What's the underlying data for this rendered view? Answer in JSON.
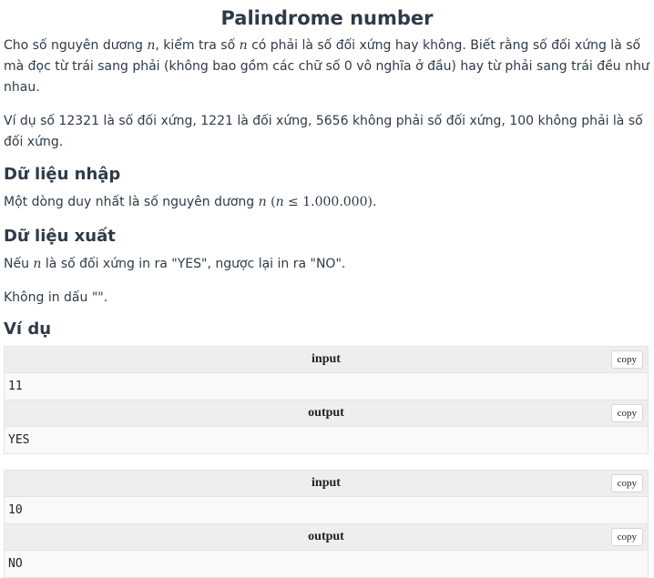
{
  "title": "Palindrome number",
  "intro": {
    "part1": "Cho số nguyên dương ",
    "var_n": "n",
    "part2": ", kiểm tra số ",
    "part3": " có phải là số đối xứng hay không. Biết rằng số đối xứng là số mà đọc từ trái sang phải (không bao gồm các chữ số 0 vô nghĩa ở đầu) hay từ phải sang trái đều như nhau."
  },
  "example_line": "Ví dụ số 12321 là số đối xứng, 1221 là đối xứng, 5656 không phải số đối xứng, 100 không phải là số đối xứng.",
  "input_section": {
    "heading": "Dữ liệu nhập",
    "text": "Một dòng duy nhất là số nguyên dương ",
    "constraint_open": "(",
    "constraint_var": "n",
    "constraint_op": " ≤ 1.000.000",
    "constraint_close": ")."
  },
  "output_section": {
    "heading": "Dữ liệu xuất",
    "text_prefix": "Nếu ",
    "text_suffix": " là số đối xứng in ra \"YES\", ngược lại in ra \"NO\".",
    "note": "Không in dấu \"\"."
  },
  "examples_heading": "Ví dụ",
  "samples": [
    {
      "input_label": "input",
      "input_value": "11",
      "output_label": "output",
      "output_value": "YES",
      "copy_label": "copy"
    },
    {
      "input_label": "input",
      "input_value": "10",
      "output_label": "output",
      "output_value": "NO",
      "copy_label": "copy"
    }
  ]
}
